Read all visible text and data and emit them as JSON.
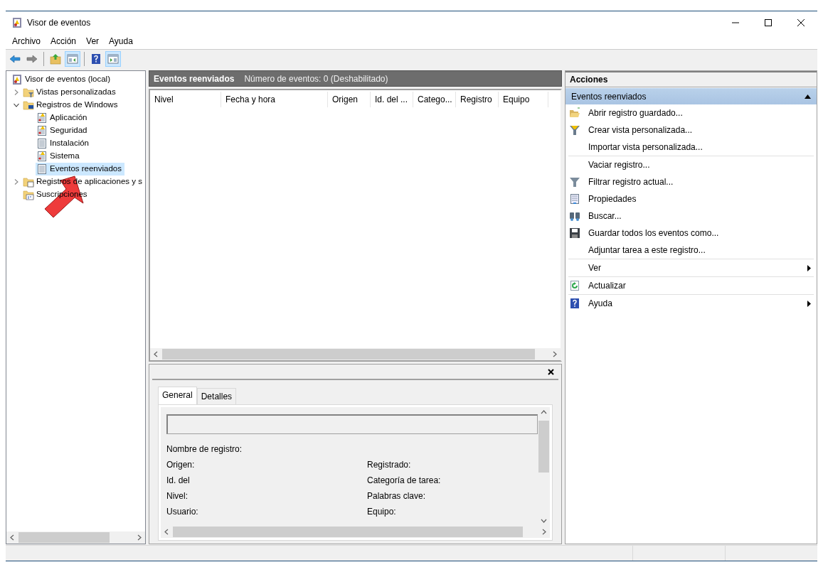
{
  "window": {
    "title": "Visor de eventos"
  },
  "menu": [
    "Archivo",
    "Acción",
    "Ver",
    "Ayuda"
  ],
  "toolbar": [
    {
      "kind": "back",
      "pressed": false
    },
    {
      "kind": "forward",
      "pressed": false
    },
    {
      "kind": "sep"
    },
    {
      "kind": "up",
      "pressed": false
    },
    {
      "kind": "tree-toggle",
      "pressed": true
    },
    {
      "kind": "sep"
    },
    {
      "kind": "help",
      "pressed": false
    },
    {
      "kind": "action-toggle",
      "pressed": true
    }
  ],
  "tree": [
    {
      "label": "Visor de eventos (local)",
      "kind": "viewer",
      "selected": false,
      "children": [
        {
          "label": "Vistas personalizadas",
          "kind": "filter-folder",
          "expanded": false,
          "selected": false
        },
        {
          "label": "Registros de Windows",
          "kind": "windows-folder",
          "expanded": true,
          "selected": false,
          "children": [
            {
              "label": "Aplicación",
              "kind": "log-warning",
              "selected": false
            },
            {
              "label": "Seguridad",
              "kind": "log-warning",
              "selected": false
            },
            {
              "label": "Instalación",
              "kind": "log",
              "selected": false
            },
            {
              "label": "Sistema",
              "kind": "log-warning",
              "selected": false
            },
            {
              "label": "Eventos reenviados",
              "kind": "log",
              "selected": true
            }
          ]
        },
        {
          "label": "Registros de aplicaciones y s",
          "kind": "app-folder",
          "expanded": false,
          "selected": false
        },
        {
          "label": "Suscripciones",
          "kind": "subscriptions",
          "selected": false
        }
      ]
    }
  ],
  "center": {
    "title": "Eventos reenviados",
    "subtitle": "Número de eventos: 0 (Deshabilitado)",
    "columns": [
      "Nivel",
      "Fecha y hora",
      "Origen",
      "Id. del ...",
      "Catego...",
      "Registro",
      "Equipo"
    ]
  },
  "details": {
    "tabs": [
      {
        "label": "General",
        "selected": true
      },
      {
        "label": "Detalles",
        "selected": false
      }
    ],
    "fields_left": [
      "Origen:",
      "Id. del",
      "Nivel:",
      "Usuario:"
    ],
    "log_name": "Nombre de registro:",
    "fields_right": [
      "Registrado:",
      "Categoría de tarea:",
      "Palabras clave:",
      "Equipo:"
    ]
  },
  "actions": {
    "title": "Acciones",
    "section": {
      "label": "Eventos reenviados",
      "expanded": true
    },
    "items": [
      {
        "label": "Abrir registro guardado...",
        "kind": "open",
        "separator_before": false,
        "submenu": false
      },
      {
        "label": "Crear vista personalizada...",
        "kind": "create-view",
        "separator_before": false,
        "submenu": false
      },
      {
        "label": "Importar vista personalizada...",
        "kind": "none",
        "separator_before": false,
        "submenu": false
      },
      {
        "label": "Vaciar registro...",
        "kind": "none",
        "separator_before": true,
        "submenu": false
      },
      {
        "label": "Filtrar registro actual...",
        "kind": "filter",
        "separator_before": false,
        "submenu": false
      },
      {
        "label": "Propiedades",
        "kind": "properties",
        "separator_before": false,
        "submenu": false
      },
      {
        "label": "Buscar...",
        "kind": "find",
        "separator_before": false,
        "submenu": false
      },
      {
        "label": "Guardar todos los eventos como...",
        "kind": "save",
        "separator_before": false,
        "submenu": false
      },
      {
        "label": "Adjuntar tarea a este registro...",
        "kind": "none",
        "separator_before": false,
        "submenu": false
      },
      {
        "label": "Ver",
        "kind": "none",
        "separator_before": true,
        "submenu": true
      },
      {
        "label": "Actualizar",
        "kind": "refresh",
        "separator_before": true,
        "submenu": false
      },
      {
        "label": "Ayuda",
        "kind": "help",
        "separator_before": true,
        "submenu": true
      }
    ]
  }
}
